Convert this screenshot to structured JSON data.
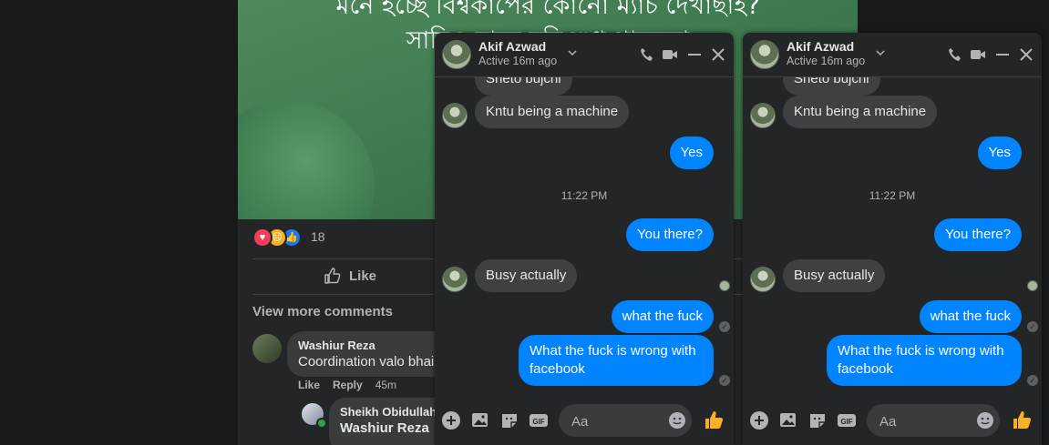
{
  "post": {
    "caption_line_1": "মনে হচ্ছে বিশ্বকাপের কোনো ম্যাচ দেখাছাই?",
    "caption_line_2": "সাদিও মানে যদি শুধু থাকতো",
    "reaction_count": "18",
    "like_label": "Like",
    "view_more_comments": "View more comments",
    "comments": [
      {
        "author": "Washiur Reza",
        "text": "Coordination valo bhai",
        "like_label": "Like",
        "reply_label": "Reply",
        "time": "45m"
      },
      {
        "author": "Sheikh Obidullah",
        "text": "Washiur Reza"
      }
    ]
  },
  "chat_windows": [
    {
      "name": "Akif Azwad",
      "status": "Active 16m ago",
      "partial_message": "Sheto bujchi",
      "messages": [
        {
          "from": "them",
          "text": "Kntu being a machine"
        },
        {
          "from": "me",
          "text": "Yes"
        },
        {
          "from": "system",
          "text": "11:22 PM"
        },
        {
          "from": "me",
          "text": "You there?"
        },
        {
          "from": "them",
          "text": "Busy actually"
        },
        {
          "from": "me",
          "text": "what the fuck"
        },
        {
          "from": "me",
          "text": "What the fuck is wrong with facebook"
        }
      ],
      "composer_placeholder": "Aa"
    },
    {
      "name": "Akif Azwad",
      "status": "Active 16m ago",
      "partial_message": "Sheto bujchi",
      "messages": [
        {
          "from": "them",
          "text": "Kntu being a machine"
        },
        {
          "from": "me",
          "text": "Yes"
        },
        {
          "from": "system",
          "text": "11:22 PM"
        },
        {
          "from": "me",
          "text": "You there?"
        },
        {
          "from": "them",
          "text": "Busy actually"
        },
        {
          "from": "me",
          "text": "what the fuck"
        },
        {
          "from": "me",
          "text": "What the fuck is wrong with facebook"
        }
      ],
      "composer_placeholder": "Aa"
    }
  ],
  "icons": [
    "love-reaction-icon",
    "sad-reaction-icon",
    "like-reaction-icon",
    "like-icon",
    "phone-icon",
    "video-icon",
    "minimize-icon",
    "close-icon",
    "chevron-down-icon",
    "plus-icon",
    "image-icon",
    "sticker-icon",
    "gif-icon",
    "emoji-icon",
    "thumbs-up-icon"
  ],
  "colors": {
    "accent": "#0084ff",
    "background": "#18191a",
    "panel": "#242526",
    "bubble_in": "#3e4042"
  }
}
